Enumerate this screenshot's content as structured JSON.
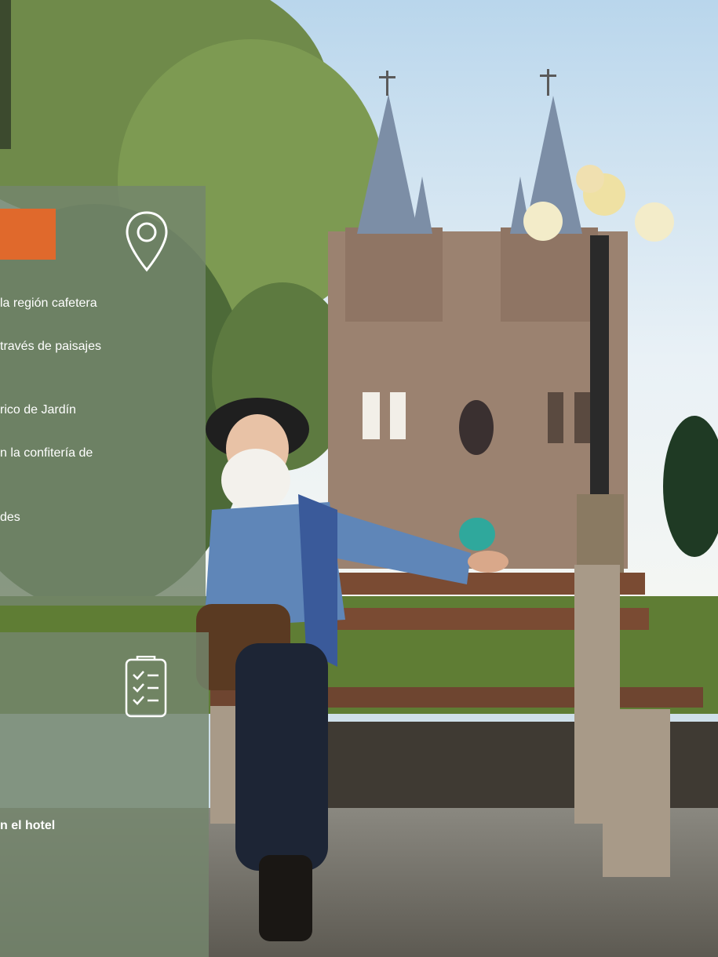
{
  "panels": {
    "top": {
      "accent_color": "#e0692c",
      "icon": "location-pin-icon",
      "lines": [
        "la región cafetera",
        "través de paisajes",
        "rico de Jardín",
        "n la confitería de",
        "des"
      ]
    },
    "bottom": {
      "icon": "checklist-icon",
      "bold_line": "n el hotel"
    }
  },
  "photo": {
    "subject": "Man with white beard on park bench in front of basilica with lamp post"
  },
  "colors": {
    "panel": "#74866c",
    "accent": "#e0692c",
    "text": "#ffffff"
  }
}
